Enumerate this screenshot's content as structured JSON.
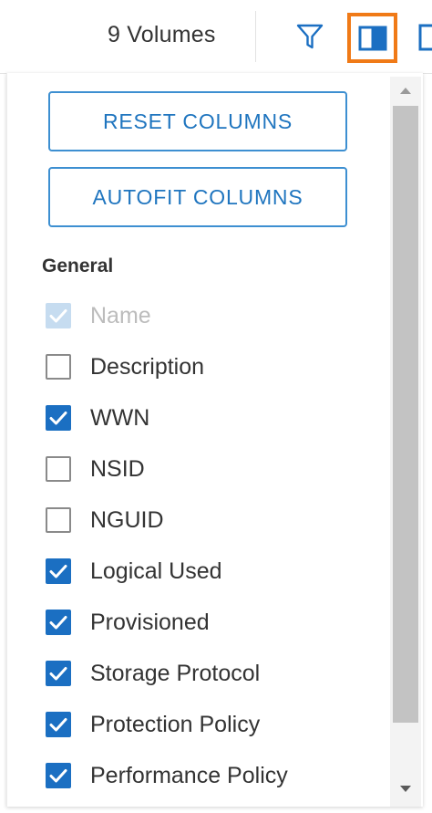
{
  "toolbar": {
    "volume_count": "9 Volumes",
    "filter_icon": "filter-icon",
    "columns_icon": "columns-icon"
  },
  "panel": {
    "reset_label": "RESET COLUMNS",
    "autofit_label": "AUTOFIT COLUMNS",
    "section_title": "General",
    "options": [
      {
        "label": "Name",
        "checked": true,
        "disabled": true
      },
      {
        "label": "Description",
        "checked": false,
        "disabled": false
      },
      {
        "label": "WWN",
        "checked": true,
        "disabled": false
      },
      {
        "label": "NSID",
        "checked": false,
        "disabled": false
      },
      {
        "label": "NGUID",
        "checked": false,
        "disabled": false
      },
      {
        "label": "Logical Used",
        "checked": true,
        "disabled": false
      },
      {
        "label": "Provisioned",
        "checked": true,
        "disabled": false
      },
      {
        "label": "Storage Protocol",
        "checked": true,
        "disabled": false
      },
      {
        "label": "Protection Policy",
        "checked": true,
        "disabled": false
      },
      {
        "label": "Performance Policy",
        "checked": true,
        "disabled": false
      }
    ]
  },
  "colors": {
    "accent_blue": "#1b6fc2",
    "highlight_orange": "#f07a17",
    "button_border": "#3d8fd1"
  }
}
